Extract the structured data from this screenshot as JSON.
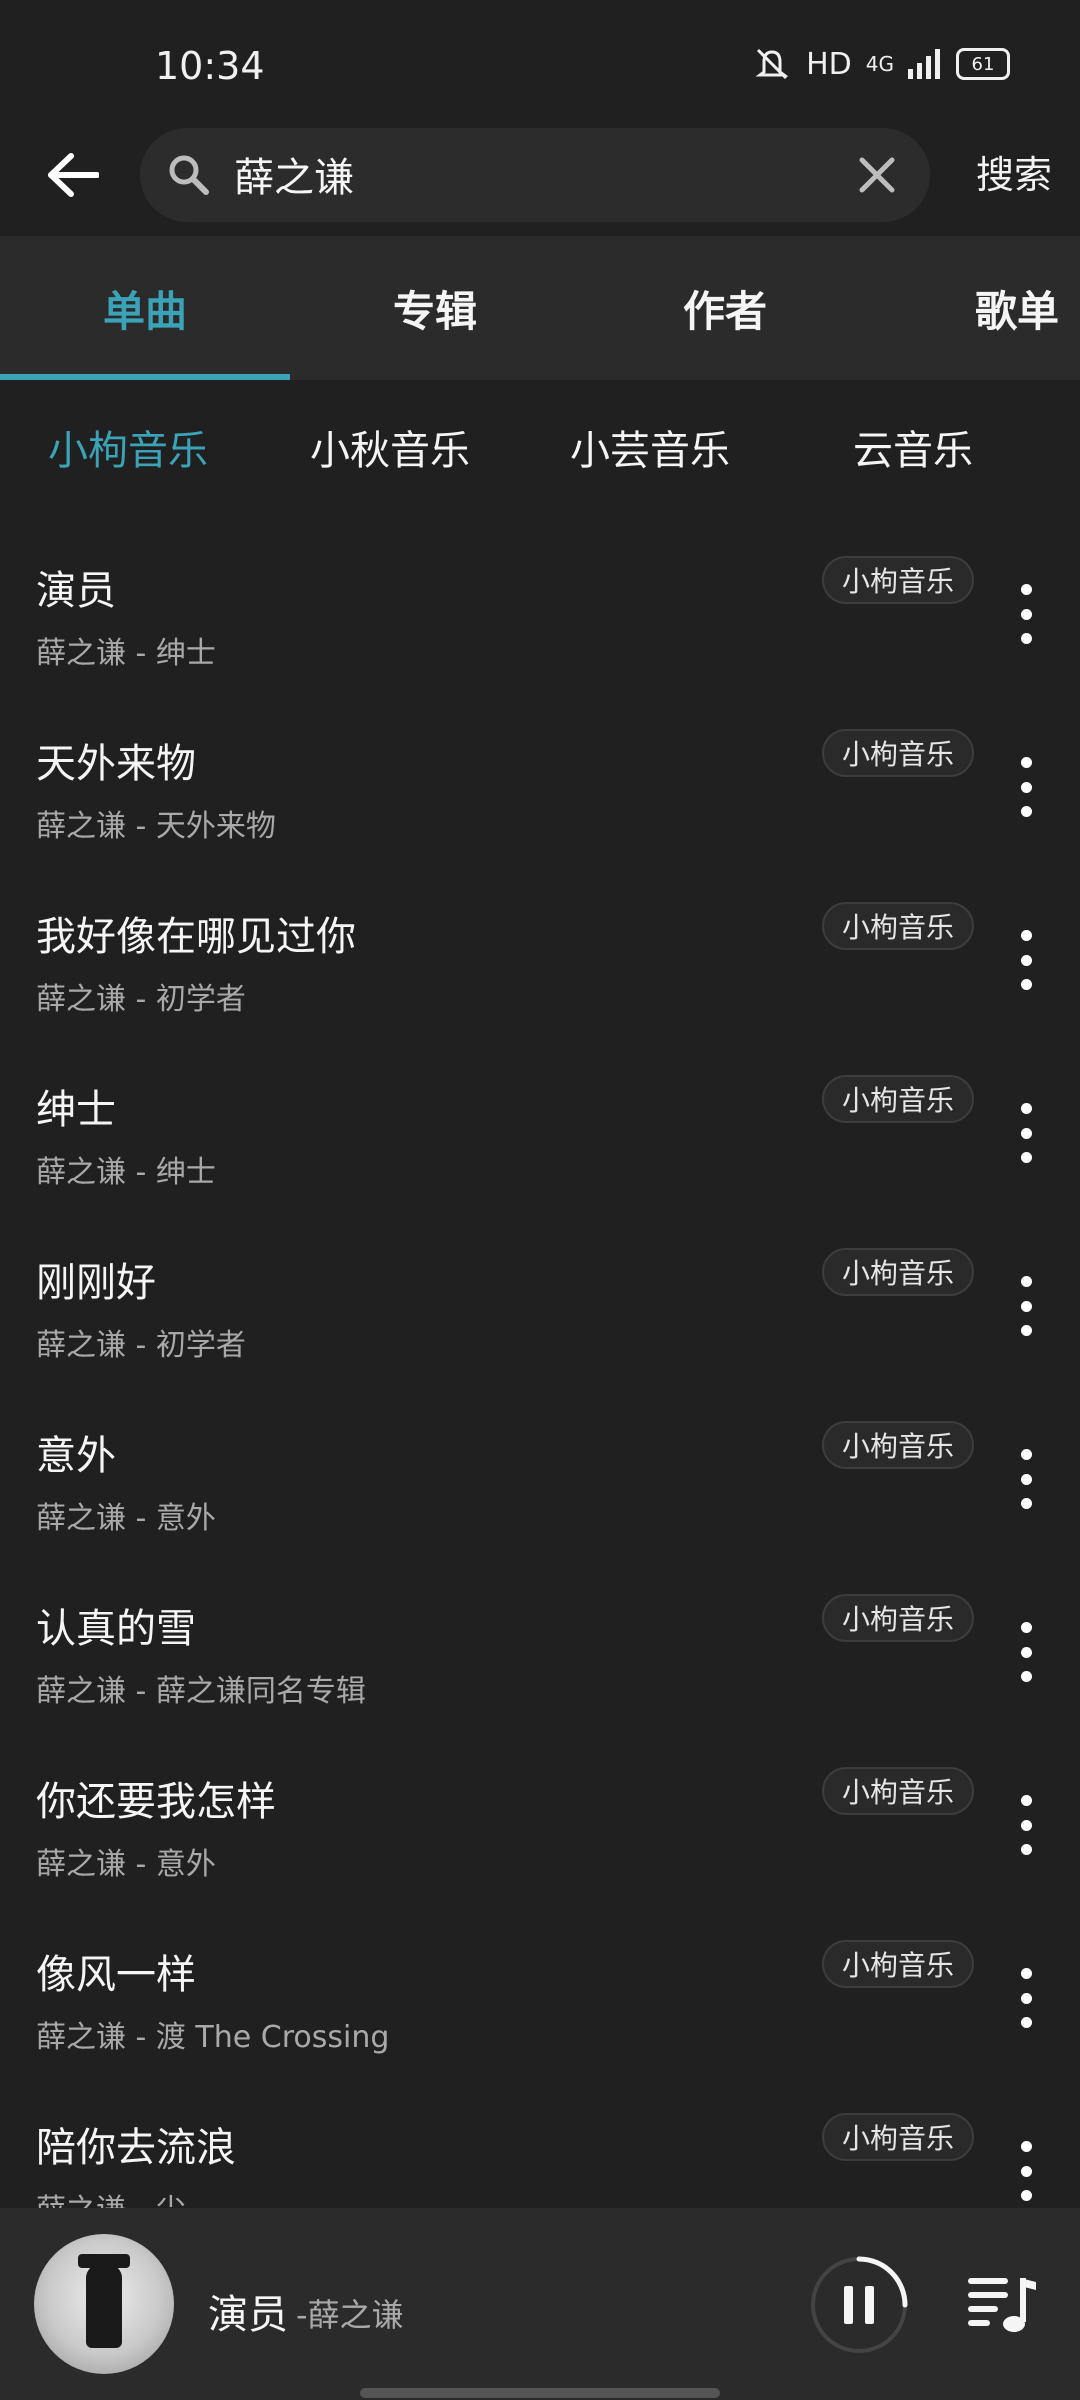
{
  "status_bar": {
    "time": "10:34",
    "network": "HD",
    "signal": "4G",
    "battery": "61"
  },
  "search": {
    "query": "薛之谦",
    "submit_label": "搜索"
  },
  "tabs": [
    {
      "label": "单曲"
    },
    {
      "label": "专辑"
    },
    {
      "label": "作者"
    },
    {
      "label": "歌单"
    }
  ],
  "sources": [
    {
      "label": "小枸音乐"
    },
    {
      "label": "小秋音乐"
    },
    {
      "label": "小芸音乐"
    },
    {
      "label": "云音乐"
    }
  ],
  "songs": [
    {
      "title": "演员",
      "subtitle": "薛之谦 - 绅士",
      "source": "小枸音乐"
    },
    {
      "title": "天外来物",
      "subtitle": "薛之谦 - 天外来物",
      "source": "小枸音乐"
    },
    {
      "title": "我好像在哪见过你",
      "subtitle": "薛之谦 - 初学者",
      "source": "小枸音乐"
    },
    {
      "title": "绅士",
      "subtitle": "薛之谦 - 绅士",
      "source": "小枸音乐"
    },
    {
      "title": "刚刚好",
      "subtitle": "薛之谦 - 初学者",
      "source": "小枸音乐"
    },
    {
      "title": "意外",
      "subtitle": "薛之谦 - 意外",
      "source": "小枸音乐"
    },
    {
      "title": "认真的雪",
      "subtitle": "薛之谦 - 薛之谦同名专辑",
      "source": "小枸音乐"
    },
    {
      "title": "你还要我怎样",
      "subtitle": "薛之谦 - 意外",
      "source": "小枸音乐"
    },
    {
      "title": "像风一样",
      "subtitle": "薛之谦 - 渡 The Crossing",
      "source": "小枸音乐"
    },
    {
      "title": "陪你去流浪",
      "subtitle": "薛之谦 - 尘",
      "source": "小枸音乐"
    }
  ],
  "player": {
    "song": "演员",
    "artist": "-薛之谦"
  },
  "colors": {
    "accent": "#3ba3b8",
    "background": "#202020",
    "tab_bar": "#2b2b2b"
  }
}
